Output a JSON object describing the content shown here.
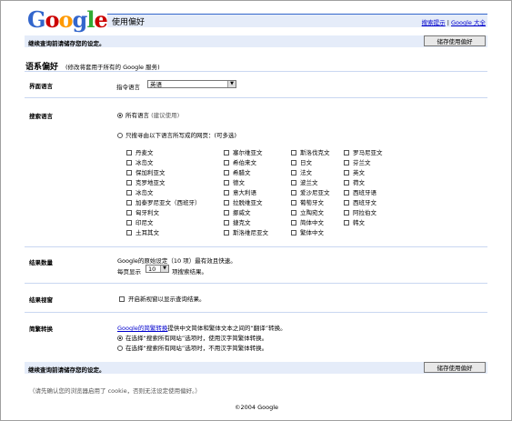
{
  "logo": {
    "text": "Google",
    "letters": [
      "G",
      "o",
      "o",
      "g",
      "l",
      "e"
    ],
    "colors": [
      "#3366cc",
      "#cc0000",
      "#ff9900",
      "#3366cc",
      "#33aa33",
      "#cc0000"
    ]
  },
  "header": {
    "title": "使用偏好",
    "links": [
      "搜索提示",
      "Google 大全"
    ],
    "sep": "|"
  },
  "top_bar": {
    "note": "继续查询前请储存您的设定。",
    "save_label": "储存使用偏好"
  },
  "global_prefs": {
    "title": "语系偏好",
    "subtitle": "(修改将套用于所有的 Google 服务)"
  },
  "interface_lang": {
    "label": "界面语言",
    "prompt": "指令语言",
    "selected": "英语"
  },
  "search_lang": {
    "label": "搜索语言",
    "option_all": "所有语言",
    "option_all_note": "(建议使用)",
    "option_some": "只搜寻由以下语言所写成的网页：(可多选)",
    "all_selected": true,
    "columns": [
      [
        "丹麦文",
        "冰岛文",
        "保加利亚文",
        "克罗地亚文",
        "冰岛文",
        "加泰罗尼亚文（西班牙）",
        "匈牙利文",
        "印尼文",
        "土耳其文"
      ],
      [
        "塞尔维亚文",
        "希伯来文",
        "希腊文",
        "德文",
        "意大利语",
        "拉脱维亚文",
        "挪威文",
        "捷克文",
        "斯洛维尼亚文"
      ],
      [
        "斯洛伐克文",
        "日文",
        "法文",
        "波兰文",
        "爱沙尼亚文",
        "葡萄牙文",
        "立陶宛文",
        "简体中文",
        "繁体中文"
      ],
      [
        "罗马尼亚文",
        "芬兰文",
        "英文",
        "荷文",
        "西班牙语",
        "西班牙文",
        "阿拉伯文",
        "韩文"
      ]
    ]
  },
  "results_count": {
    "label": "结果数量",
    "desc": "Google的原始设定（10 项）最有效且快速。",
    "prefix": "每页显示",
    "value": "10",
    "suffix": "项搜索结果。"
  },
  "results_window": {
    "label": "结果视窗",
    "option": "开启新视窗以显示查询结果。"
  },
  "conversion": {
    "label": "简繁转换",
    "desc_link": "Google的简繁转换",
    "desc_rest": "提供中文简体和繁体文本之间的“翻译”转换。",
    "opt1": "在选择“搜索所有网站”选项时，使用汉字简繁体转换。",
    "opt2": "在选择“搜索所有网站”选项时，不用汉字简繁体转换。",
    "opt1_selected": true
  },
  "bottom_bar": {
    "note": "继续查询前请储存您的设定。",
    "save_label": "储存使用偏好"
  },
  "cookie_note": "（请先确认您的浏览器启用了 cookie，否则无法设定使用偏好。）",
  "footer": "©2004 Google"
}
